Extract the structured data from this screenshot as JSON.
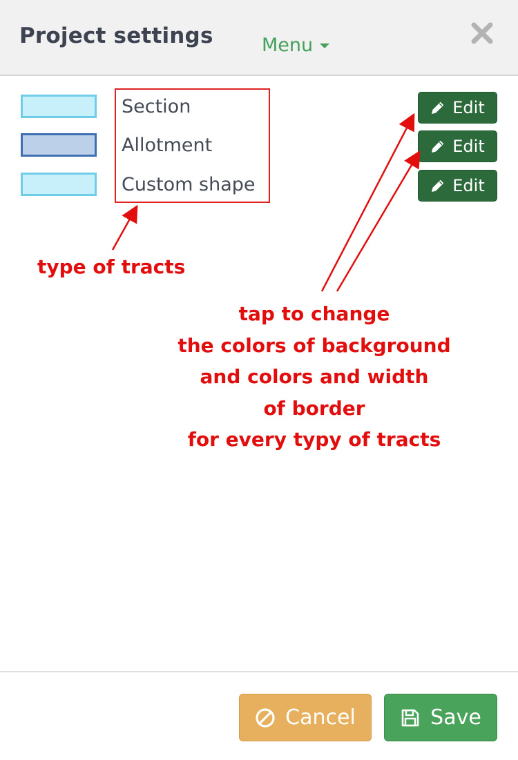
{
  "header": {
    "title": "Project settings",
    "menu_label": "Menu",
    "close_icon": "close-icon"
  },
  "tract_types": [
    {
      "label": "Section",
      "fill": "#c8f0fb",
      "border": "#6fcde8",
      "edit_label": "Edit"
    },
    {
      "label": "Allotment",
      "fill": "#bcd0ea",
      "border": "#3f6fb3",
      "edit_label": "Edit"
    },
    {
      "label": "Custom shape",
      "fill": "#c8f0fb",
      "border": "#6fcde8",
      "edit_label": "Edit"
    }
  ],
  "annotations": {
    "type_label": "type of tracts",
    "tap_lines": [
      "tap to change",
      "the colors of background",
      "and colors and width",
      "of border",
      "for every typy of tracts"
    ],
    "color": "#e20e0e"
  },
  "footer": {
    "cancel_label": "Cancel",
    "save_label": "Save",
    "cancel_color": "#e6b05f",
    "save_color": "#4aa35a"
  },
  "colors": {
    "edit_button": "#2c6a3b",
    "menu_accent": "#45a15a",
    "title_text": "#3d4350"
  }
}
